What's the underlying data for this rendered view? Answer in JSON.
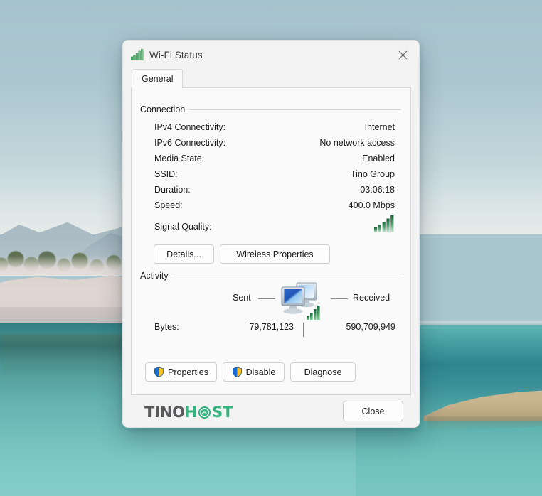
{
  "window": {
    "title": "Wi-Fi Status",
    "icon": "wifi-signal-icon",
    "close_icon": "close-icon"
  },
  "tabs": [
    {
      "label": "General",
      "active": true
    }
  ],
  "connection": {
    "group_label": "Connection",
    "rows": [
      {
        "label": "IPv4 Connectivity:",
        "value": "Internet"
      },
      {
        "label": "IPv6 Connectivity:",
        "value": "No network access"
      },
      {
        "label": "Media State:",
        "value": "Enabled"
      },
      {
        "label": "SSID:",
        "value": "Tino Group"
      },
      {
        "label": "Duration:",
        "value": "03:06:18"
      },
      {
        "label": "Speed:",
        "value": "400.0 Mbps"
      }
    ],
    "signal_quality_label": "Signal Quality:",
    "signal_quality_bars": 5,
    "signal_icon": "signal-bars-icon",
    "buttons": [
      {
        "label": "Details...",
        "mnemonic_index": 1
      },
      {
        "label": "Wireless Properties",
        "mnemonic_index": 0
      }
    ]
  },
  "activity": {
    "group_label": "Activity",
    "sent_label": "Sent",
    "received_label": "Received",
    "center_icon": "two-monitors-network-icon",
    "bytes_label": "Bytes:",
    "bytes_sent": "79,781,123",
    "bytes_received": "590,709,949"
  },
  "actions": [
    {
      "label": "Properties",
      "mnemonic_index": 0,
      "icon": "uac-shield-icon"
    },
    {
      "label": "Disable",
      "mnemonic_index": 0,
      "icon": "uac-shield-icon"
    },
    {
      "label": "Diagnose",
      "mnemonic_index": 3,
      "icon": null
    }
  ],
  "footer": {
    "brand_part1": "TINO",
    "brand_h": "H",
    "brand_st": "ST",
    "brand_o_icon": "tinohost-globe-icon",
    "close_label": "Close",
    "close_mnemonic_index": 1
  },
  "colors": {
    "accent_green": "#36b37e",
    "signal_green": "#2e8b4e",
    "window_bg": "#f3f3f3",
    "panel_bg": "#fafafa",
    "text": "#1b1b1b",
    "title_text": "#3c3c3c",
    "desktop_sky": "#a9c5ce",
    "desktop_water": "#59a8a8"
  }
}
